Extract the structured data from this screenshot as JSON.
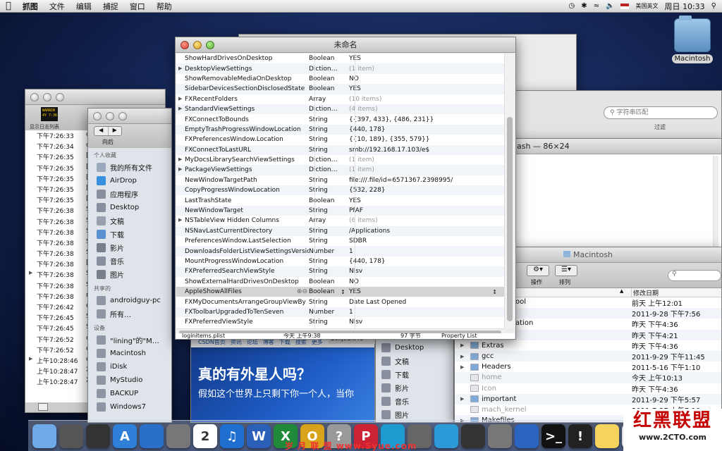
{
  "menubar": {
    "app": "抓图",
    "items": [
      "文件",
      "编辑",
      "捕捉",
      "窗口",
      "帮助"
    ],
    "input_method": "美国英文",
    "clock": "周日 10:33"
  },
  "desktop": {
    "drive_label": "Macintosh"
  },
  "console": {
    "toolbar_label": "显示日志列表",
    "warn_badge": "WARNIN\n4Y 7:36",
    "rows": [
      {
        "t": "下午7:26:33",
        "s": "or"
      },
      {
        "t": "下午7:26:34",
        "s": "or"
      },
      {
        "t": "下午7:26:35",
        "s": "[0"
      },
      {
        "t": "下午7:26:35",
        "s": "[0"
      },
      {
        "t": "下午7:26:35",
        "s": "[0"
      },
      {
        "t": "下午7:26:35",
        "s": "[0"
      },
      {
        "t": "下午7:26:35",
        "s": "[0"
      },
      {
        "t": "下午7:26:38",
        "s": "Sy"
      },
      {
        "t": "下午7:26:38",
        "s": "Sy"
      },
      {
        "t": "下午7:26:38",
        "s": "Sy"
      },
      {
        "t": "下午7:26:38",
        "s": "Sy"
      },
      {
        "t": "下午7:26:38",
        "s": "Sy"
      },
      {
        "t": "下午7:26:38",
        "s": "[0"
      },
      {
        "t": "下午7:26:38",
        "s": "Sy"
      },
      {
        "t": "下午7:26:38",
        "s": "Sy"
      },
      {
        "t": "下午7:26:38",
        "s": "nt"
      },
      {
        "t": "下午7:26:42",
        "s": "co"
      },
      {
        "t": "下午7:26:45",
        "s": "Sy"
      },
      {
        "t": "下午7:26:45",
        "s": "Sy"
      },
      {
        "t": "下午7:26:52",
        "s": "co"
      },
      {
        "t": "下午7:26:52",
        "s": "co"
      },
      {
        "t": "上午10:28:46",
        "s": "co"
      },
      {
        "t": "上午10:28:47",
        "s": "X"
      },
      {
        "t": "上午10:28:47",
        "s": "X"
      }
    ]
  },
  "finder_left": {
    "back_label": "向后",
    "sections": [
      {
        "title": "个人收藏",
        "items": [
          "我的所有文件",
          "AirDrop",
          "应用程序",
          "Desktop",
          "文稿",
          "下载",
          "影片",
          "音乐",
          "图片"
        ]
      },
      {
        "title": "共享的",
        "items": [
          "androidguy-pc",
          "所有…"
        ]
      },
      {
        "title": "设备",
        "items": [
          "\"lining\"的\"M…",
          "Macintosh",
          "iDisk",
          "MyStudio",
          "BACKUP",
          "Windows7"
        ]
      }
    ]
  },
  "plist": {
    "title": "未命名",
    "rows": [
      {
        "k": "ShowHardDrivesOnDesktop",
        "t": "Boolean",
        "v": "YES",
        "tri": false,
        "dim": false
      },
      {
        "k": "DesktopViewSettings",
        "t": "Diction…",
        "v": "(1 item)",
        "tri": true,
        "dim": true
      },
      {
        "k": "ShowRemovableMediaOnDesktop",
        "t": "Boolean",
        "v": "NO",
        "tri": false,
        "dim": false
      },
      {
        "k": "SidebarDevicesSectionDisclosedState",
        "t": "Boolean",
        "v": "YES",
        "tri": false,
        "dim": false
      },
      {
        "k": "FXRecentFolders",
        "t": "Array",
        "v": "(10 items)",
        "tri": true,
        "dim": true
      },
      {
        "k": "StandardViewSettings",
        "t": "Diction…",
        "v": "(4 items)",
        "tri": true,
        "dim": true
      },
      {
        "k": "FXConnectToBounds",
        "t": "String",
        "v": "{{397, 433}, {486, 231}}",
        "tri": false,
        "dim": false
      },
      {
        "k": "EmptyTrashProgressWindowLocation",
        "t": "String",
        "v": "{440, 178}",
        "tri": false,
        "dim": false
      },
      {
        "k": "FXPreferencesWindow.Location",
        "t": "String",
        "v": "{{10, 189}, {355, 579}}",
        "tri": false,
        "dim": false
      },
      {
        "k": "FXConnectToLastURL",
        "t": "String",
        "v": "smb://192.168.17.103/e$",
        "tri": false,
        "dim": false
      },
      {
        "k": "MyDocsLibrarySearchViewSettings",
        "t": "Diction…",
        "v": "(1 item)",
        "tri": true,
        "dim": true
      },
      {
        "k": "PackageViewSettings",
        "t": "Diction…",
        "v": "(1 item)",
        "tri": true,
        "dim": true
      },
      {
        "k": "NewWindowTargetPath",
        "t": "String",
        "v": "file:///.file/id=6571367.2398995/",
        "tri": false,
        "dim": false
      },
      {
        "k": "CopyProgressWindowLocation",
        "t": "String",
        "v": "{532, 228}",
        "tri": false,
        "dim": false
      },
      {
        "k": "LastTrashState",
        "t": "Boolean",
        "v": "YES",
        "tri": false,
        "dim": false
      },
      {
        "k": "NewWindowTarget",
        "t": "String",
        "v": "PfAF",
        "tri": false,
        "dim": false
      },
      {
        "k": "NSTableView Hidden Columns",
        "t": "Array",
        "v": "(6 items)",
        "tri": true,
        "dim": true
      },
      {
        "k": "NSNavLastCurrentDirectory",
        "t": "String",
        "v": "/Applications",
        "tri": false,
        "dim": false
      },
      {
        "k": "PreferencesWindow.LastSelection",
        "t": "String",
        "v": "SDBR",
        "tri": false,
        "dim": false
      },
      {
        "k": "DownloadsFolderListViewSettingsVersion",
        "t": "Number",
        "v": "1",
        "tri": false,
        "dim": false
      },
      {
        "k": "MountProgressWindowLocation",
        "t": "String",
        "v": "{440, 178}",
        "tri": false,
        "dim": false
      },
      {
        "k": "FXPreferredSearchViewStyle",
        "t": "String",
        "v": "Nlsv",
        "tri": false,
        "dim": false
      },
      {
        "k": "ShowExternalHardDrivesOnDesktop",
        "t": "Boolean",
        "v": "NO",
        "tri": false,
        "dim": false
      },
      {
        "k": "AppleShowAllFiles",
        "t": "Boolean",
        "v": "YES",
        "tri": false,
        "dim": false
      },
      {
        "k": "FXMyDocumentsArrangeGroupViewBy",
        "t": "String",
        "v": "Date Last Opened",
        "tri": false,
        "dim": false
      },
      {
        "k": "FXToolbarUpgradedToTenSeven",
        "t": "Number",
        "v": "1",
        "tri": false,
        "dim": false
      },
      {
        "k": "FXPreferredViewStyle",
        "t": "String",
        "v": "Nlsv",
        "tri": false,
        "dim": false
      }
    ],
    "selected_row": 23,
    "peek": {
      "name": "loginitems.plist",
      "date": "今天 上午9:38",
      "size": "97 字节",
      "kind": "Property List"
    }
  },
  "search": {
    "placeholder": "字符串匹配",
    "filter_label": "过滤"
  },
  "terminal": {
    "title": "ash — 86×24"
  },
  "browser": {
    "nav": [
      "CSDN首页",
      "资讯",
      "论坛",
      "博客",
      "下载",
      "搜索",
      "更多"
    ],
    "headline": "真的有外星人吗？",
    "subline": "假如这个世界上只剩下你一个人，当你",
    "bonjour": "Bonjour:Pre"
  },
  "finder_mid": {
    "items": [
      "Desktop",
      "文稿",
      "下载",
      "影片",
      "音乐",
      "图片"
    ]
  },
  "finder_right": {
    "title": "Macintosh",
    "action_label": "操作",
    "arrange_label": "排列",
    "col_date": "修改日期",
    "partial": [
      "ool",
      "",
      "ation",
      "",
      ""
    ],
    "rows": [
      {
        "name": "",
        "date": "前天 上午12:01",
        "folder": false,
        "dim": false
      },
      {
        "name": "",
        "date": "2011-9-28 下午7:56",
        "folder": false,
        "dim": false
      },
      {
        "name": "",
        "date": "昨天 下午4:36",
        "folder": false,
        "dim": false
      },
      {
        "name": "",
        "date": "昨天 下午4:21",
        "folder": false,
        "dim": false
      },
      {
        "name": "Extras",
        "date": "昨天 下午4:36",
        "folder": true,
        "dim": false
      },
      {
        "name": "gcc",
        "date": "2011-9-29 下午11:45",
        "folder": true,
        "dim": false
      },
      {
        "name": "Headers",
        "date": "2011-5-16 下午1:10",
        "folder": true,
        "dim": false
      },
      {
        "name": "home",
        "date": "今天 上午10:13",
        "folder": false,
        "dim": true
      },
      {
        "name": "Icon",
        "date": "昨天 下午4:36",
        "folder": false,
        "dim": true
      },
      {
        "name": "important",
        "date": "2011-9-29 下午5:57",
        "folder": true,
        "dim": false
      },
      {
        "name": "mach_kernel",
        "date": "2011-7-27 上午7:10",
        "folder": false,
        "dim": true
      },
      {
        "name": "Makefiles",
        "date": "",
        "folder": true,
        "dim": false
      }
    ]
  },
  "watermark": {
    "logo": "红黑联盟",
    "site": "www.2CTO.com",
    "dock_text": "岁 月 联 盟  www.Syue.com"
  },
  "dock": {
    "icons": [
      "finder-icon",
      "launchpad-icon",
      "mission-control-icon",
      "app-store-icon",
      "safari-icon",
      "facetime-icon",
      "ical-icon",
      "itunes-icon",
      "word-icon",
      "excel-icon",
      "powerpoint-icon",
      "help-icon",
      "pages-icon",
      "network-icon",
      "utility-icon",
      "messenger-icon",
      "vmware-icon",
      "system-prefs-icon",
      "xcode-icon",
      "terminal-icon",
      "console-icon",
      "stickies-icon",
      "x11-icon",
      "trash-icon"
    ]
  }
}
